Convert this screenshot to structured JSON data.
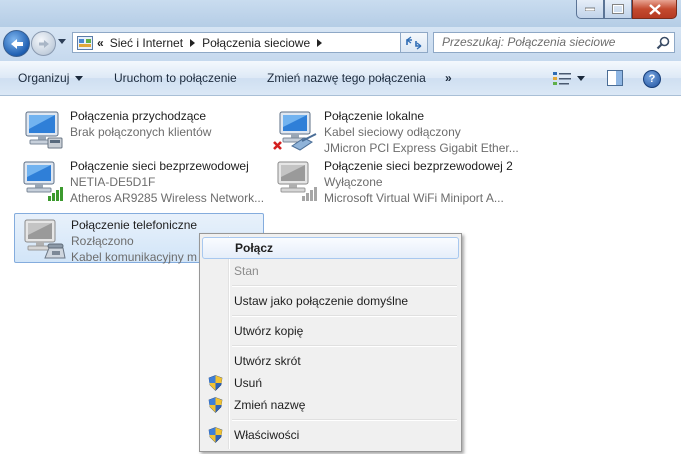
{
  "address": {
    "prefix": "«",
    "crumbs": [
      "Sieć i Internet",
      "Połączenia sieciowe"
    ]
  },
  "search": {
    "placeholder": "Przeszukaj: Połączenia sieciowe"
  },
  "toolbar": {
    "organize": "Organizuj",
    "start_connection": "Uruchom to połączenie",
    "rename_connection": "Zmień nazwę tego połączenia",
    "more": "»",
    "help": "?"
  },
  "connections": [
    {
      "name": "Połączenia przychodzące",
      "line2": "Brak połączonych klientów",
      "line3": "",
      "icon": "incoming-connections-icon"
    },
    {
      "name": "Połączenie lokalne",
      "line2": "Kabel sieciowy odłączony",
      "line3": "JMicron PCI Express Gigabit Ether...",
      "icon": "lan-disconnected-icon"
    },
    {
      "name": "Połączenie sieci bezprzewodowej",
      "line2": "NETIA-DE5D1F",
      "line3": "Atheros AR9285 Wireless Network...",
      "icon": "wireless-connected-icon"
    },
    {
      "name": "Połączenie sieci bezprzewodowej 2",
      "line2": "Wyłączone",
      "line3": "Microsoft Virtual WiFi Miniport A...",
      "icon": "wireless-disabled-icon"
    },
    {
      "name": "Połączenie telefoniczne",
      "line2": "Rozłączono",
      "line3": "Kabel komunikacyjny m",
      "icon": "dialup-connection-icon"
    }
  ],
  "context_menu": {
    "connect": "Połącz",
    "status": "Stan",
    "set_default": "Ustaw jako połączenie domyślne",
    "create_copy": "Utwórz kopię",
    "create_shortcut": "Utwórz skrót",
    "delete": "Usuń",
    "rename": "Zmień nazwę",
    "properties": "Właściwości"
  },
  "colors": {
    "accent": "#1f5fb1",
    "selection": "#d2e5f8",
    "signal_green": "#3c9a2e"
  }
}
